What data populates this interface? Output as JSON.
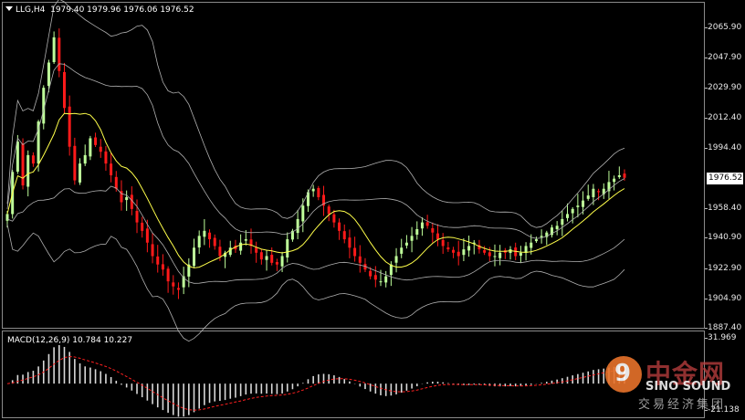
{
  "header": {
    "symbol": "LLG,H4",
    "ohlc": "1979.40 1979.96 1976.06 1976.52"
  },
  "macd_header": "MACD(12,26,9) 10.784 10.227",
  "current_price": "1976.52",
  "price_axis": {
    "ticks": [
      "2065.90",
      "2047.90",
      "2029.90",
      "2012.40",
      "1994.40",
      "1958.40",
      "1940.90",
      "1922.90",
      "1904.90",
      "1887.40"
    ],
    "min": 1887.4,
    "max": 2065.9
  },
  "macd_axis": {
    "ticks": [
      "31.969",
      "-21.138"
    ]
  },
  "colors": {
    "bull": "#bfff9a",
    "bear": "#ff1a1a",
    "ma": "#ffff4a",
    "bands": "#b0b0b0",
    "histogram": "#d9d9d9",
    "signal": "#ff2020"
  },
  "watermark": {
    "logo_glyph": "9",
    "cn": "中金网",
    "en": "SINO SOUND",
    "sub": "交易经济集团"
  },
  "chart_data": {
    "type": "candlestick",
    "symbol": "LLG",
    "timeframe": "H4",
    "closes": [
      1955,
      1980,
      1998,
      1972,
      1990,
      1985,
      2010,
      2030,
      2045,
      2060,
      2040,
      2018,
      1995,
      1975,
      1985,
      1990,
      2000,
      1996,
      1992,
      1985,
      1978,
      1970,
      1962,
      1965,
      1958,
      1950,
      1945,
      1938,
      1930,
      1925,
      1922,
      1915,
      1912,
      1910,
      1918,
      1925,
      1935,
      1942,
      1945,
      1940,
      1936,
      1930,
      1932,
      1935,
      1934,
      1938,
      1940,
      1936,
      1932,
      1928,
      1930,
      1926,
      1925,
      1930,
      1940,
      1945,
      1952,
      1960,
      1968,
      1970,
      1965,
      1960,
      1955,
      1950,
      1945,
      1940,
      1935,
      1930,
      1926,
      1922,
      1918,
      1916,
      1915,
      1918,
      1925,
      1930,
      1935,
      1938,
      1942,
      1946,
      1950,
      1948,
      1944,
      1940,
      1936,
      1934,
      1932,
      1930,
      1934,
      1936,
      1938,
      1934,
      1932,
      1930,
      1930,
      1932,
      1932,
      1934,
      1930,
      1932,
      1936,
      1938,
      1940,
      1942,
      1944,
      1947,
      1948,
      1952,
      1955,
      1958,
      1960,
      1963,
      1966,
      1970,
      1968,
      1970,
      1974,
      1976,
      1978,
      1976.52
    ],
    "macd_histogram_range": [
      -21.138,
      31.969
    ],
    "macd_last": 10.784,
    "signal_last": 10.227
  }
}
